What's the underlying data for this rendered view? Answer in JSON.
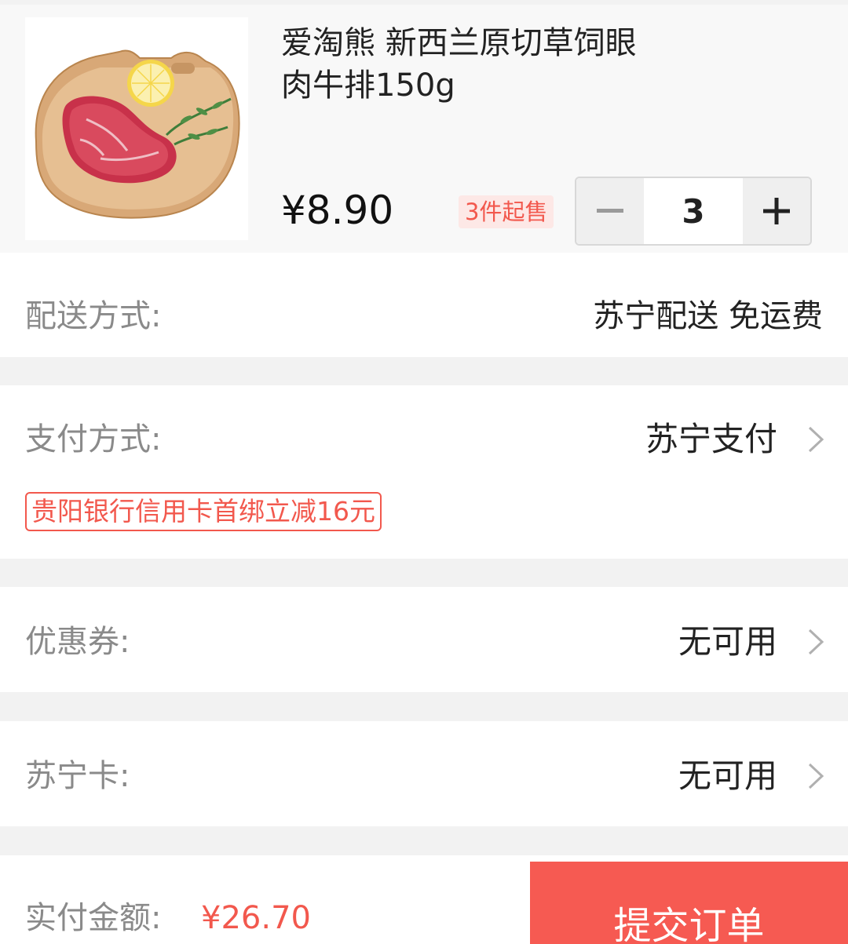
{
  "product": {
    "title_line1": "爱淘熊 新西兰原切草饲眼",
    "title_line2": "肉牛排150g",
    "price": "¥8.90",
    "min_purchase": "3件起售",
    "quantity": "3",
    "image_icon": "steak-on-board-image"
  },
  "delivery": {
    "label": "配送方式:",
    "value": "苏宁配送 免运费"
  },
  "payment": {
    "label": "支付方式:",
    "value": "苏宁支付",
    "promo": "贵阳银行信用卡首绑立减16元"
  },
  "coupon": {
    "label": "优惠券:",
    "value": "无可用"
  },
  "card": {
    "label": "苏宁卡:",
    "value": "无可用"
  },
  "footer": {
    "total_label": "实付金额:",
    "total_value": "¥26.70",
    "submit_label": "提交订单"
  },
  "colors": {
    "accent": "#f65a52",
    "price_red": "#f2584d",
    "background": "#f2f2f2"
  }
}
